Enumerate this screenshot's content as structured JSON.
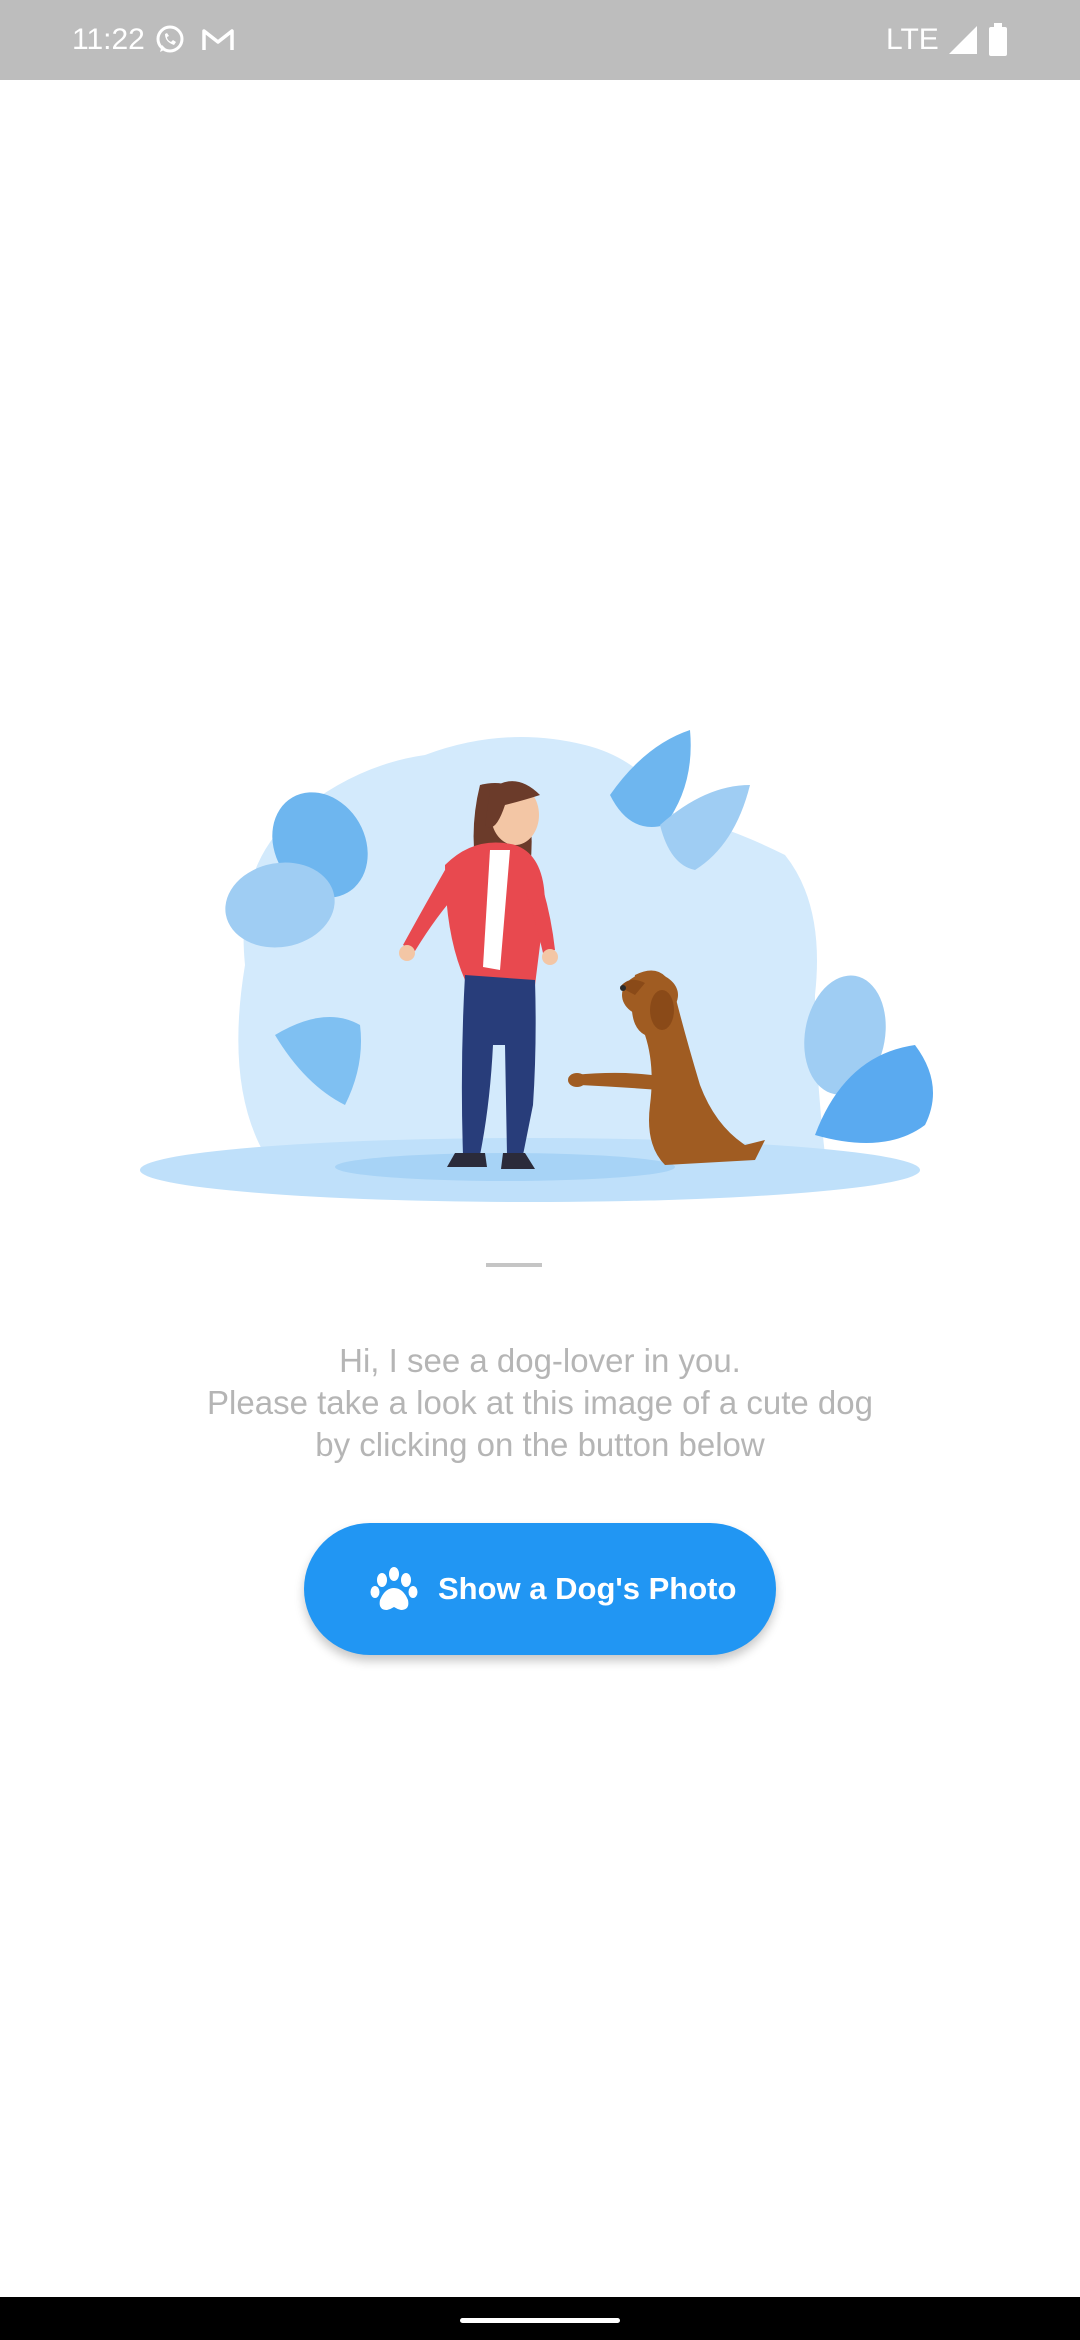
{
  "status_bar": {
    "time": "11:22",
    "network": "LTE",
    "notification_icons": [
      "whatsapp-icon",
      "gmail-icon"
    ],
    "background_color": "#bdbdbd"
  },
  "main": {
    "message_lines": [
      "Hi, I see a dog-lover in you.",
      "Please take a look at this image of a cute dog",
      "by clicking on the button below"
    ],
    "button": {
      "label": "Show a Dog's Photo",
      "icon": "paw-icon",
      "color": "#2196f3"
    }
  },
  "illustration": {
    "subject": "woman-greeting-dog-illustration"
  }
}
